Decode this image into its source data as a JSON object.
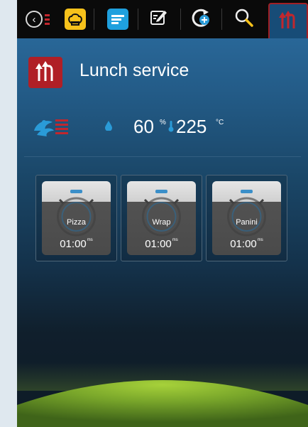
{
  "program": {
    "title": "Lunch service"
  },
  "status": {
    "humidity_value": "60",
    "humidity_unit": "%",
    "temperature_value": "225",
    "temperature_unit": "°C"
  },
  "timers": [
    {
      "name": "Pizza",
      "time": "01:00",
      "unit": "ms"
    },
    {
      "name": "Wrap",
      "time": "01:00",
      "unit": "ms"
    },
    {
      "name": "Panini",
      "time": "01:00",
      "unit": "ms"
    }
  ],
  "icons": {
    "back": "back-icon",
    "heat": "heat-lines-icon",
    "chef": "chef-hat-icon",
    "list": "list-icon",
    "edit": "edit-icon",
    "refresh": "plus-cycle-icon",
    "search": "search-icon",
    "program": "program-arrows-icon",
    "steam": "steam-mode-icon",
    "humidity": "droplet-icon",
    "temperature": "thermometer-icon",
    "timer": "stopwatch-icon"
  },
  "colors": {
    "accent_red": "#b01f26",
    "accent_yellow": "#f7c21b",
    "accent_blue": "#1fa0de",
    "planet_green": "#8db82e"
  }
}
